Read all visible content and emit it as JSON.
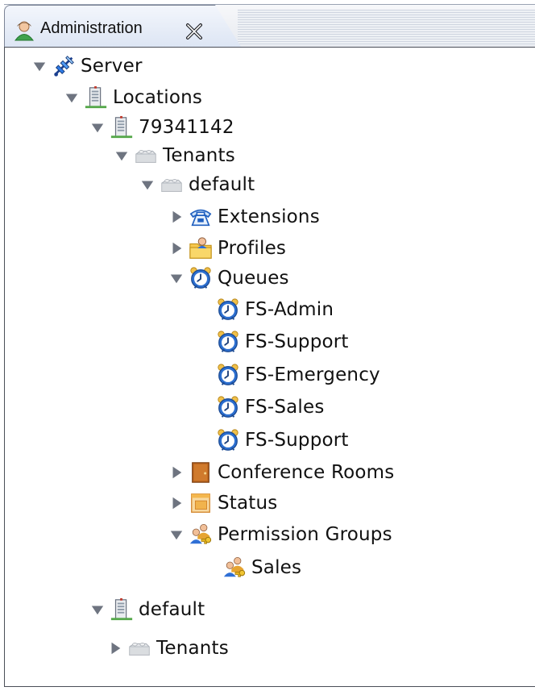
{
  "tab": {
    "title": "Administration",
    "icon": "user-icon",
    "close_icon": "close-icon"
  },
  "tree": {
    "server": {
      "label": "Server",
      "expanded": true
    },
    "locations": {
      "label": "Locations",
      "expanded": true
    },
    "location_1": {
      "label": "79341142",
      "expanded": true
    },
    "tenants_1": {
      "label": "Tenants",
      "expanded": true
    },
    "tenant_default": {
      "label": "default",
      "expanded": true
    },
    "extensions": {
      "label": "Extensions",
      "expanded": false
    },
    "profiles": {
      "label": "Profiles",
      "expanded": false
    },
    "queues": {
      "label": "Queues",
      "expanded": true
    },
    "queue_items": [
      "FS-Admin",
      "FS-Support",
      "FS-Emergency",
      "FS-Sales",
      "FS-Support"
    ],
    "conference_rooms": {
      "label": "Conference Rooms",
      "expanded": false
    },
    "status": {
      "label": "Status",
      "expanded": false
    },
    "permission_groups": {
      "label": "Permission Groups",
      "expanded": true
    },
    "permission_items": [
      "Sales"
    ],
    "location_2": {
      "label": "default",
      "expanded": true
    },
    "tenants_2": {
      "label": "Tenants",
      "expanded": false
    }
  },
  "colors": {
    "tree_text": "#111111",
    "panel_border": "#4b4f58",
    "twisty": "#6b7280"
  }
}
